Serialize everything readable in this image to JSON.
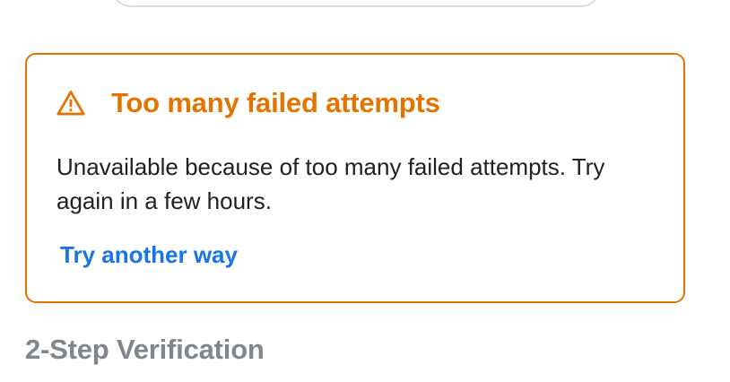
{
  "alert": {
    "icon": "warning-triangle-icon",
    "title": "Too many failed attempts",
    "message": "Unavailable because of too many failed attempts. Try again in a few hours.",
    "link_label": "Try another way",
    "accent_color": "#e37400",
    "link_color": "#1a73e8"
  },
  "section": {
    "heading": "2-Step Verification"
  }
}
